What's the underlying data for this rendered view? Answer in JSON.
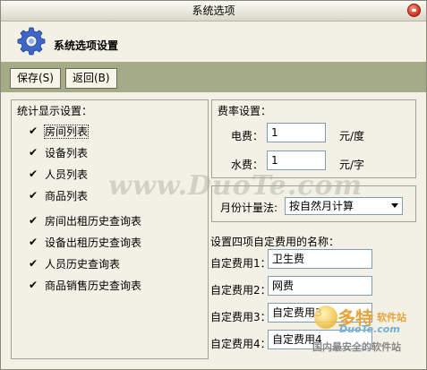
{
  "window": {
    "title": "系统选项"
  },
  "header": {
    "title": "系统选项设置"
  },
  "toolbar": {
    "save_label": "保存(S)",
    "back_label": "返回(B)"
  },
  "stats": {
    "title": "统计显示设置：",
    "items": [
      {
        "label": "房间列表",
        "checked": true
      },
      {
        "label": "设备列表",
        "checked": true
      },
      {
        "label": "人员列表",
        "checked": true
      },
      {
        "label": "商品列表",
        "checked": true
      },
      {
        "label": "房间出租历史查询表",
        "checked": true
      },
      {
        "label": "设备出租历史查询表",
        "checked": true
      },
      {
        "label": "人员历史查询表",
        "checked": true
      },
      {
        "label": "商品销售历史查询表",
        "checked": true
      }
    ]
  },
  "rates": {
    "title": "费率设置：",
    "electric_label": "电费：",
    "electric_value": "1",
    "electric_unit": "元/度",
    "water_label": "水费：",
    "water_value": "1",
    "water_unit": "元/字"
  },
  "monthly": {
    "label": "月份计量法:",
    "selected": "按自然月计算"
  },
  "custom_fees": {
    "title": "设置四项自定费用的名称：",
    "items": [
      {
        "label": "自定费用1：",
        "value": "卫生费"
      },
      {
        "label": "自定费用2：",
        "value": "网费"
      },
      {
        "label": "自定费用3：",
        "value": "自定费用3"
      },
      {
        "label": "自定费用4：",
        "value": "自定费用4"
      }
    ]
  },
  "watermarks": {
    "center": "www.DuoTe.com",
    "corner_brand": "多特",
    "corner_brand_small": "软件站",
    "corner_url": "DuoTe.com",
    "corner_slogan": "国内最安全的软件站"
  },
  "colors": {
    "toolbar_bg": "#a6ab87",
    "window_bg": "#f3f1e6",
    "close_button": "#d63a25"
  }
}
